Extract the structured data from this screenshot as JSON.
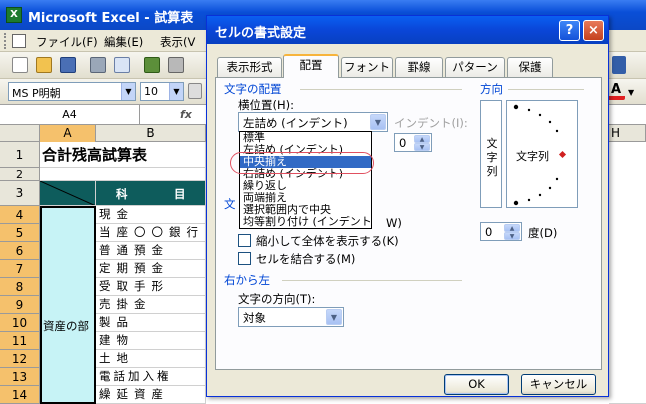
{
  "excel": {
    "title": "Microsoft Excel - 試算表",
    "app_icon": "excel-icon",
    "menu": [
      "ファイル(F)",
      "編集(E)",
      "表示(V"
    ],
    "font_name": "MS P明朝",
    "font_size": "10",
    "name_box": "A4",
    "fx": "fx",
    "columns": [
      "A",
      "B",
      "H"
    ],
    "rows": [
      "1",
      "2",
      "3",
      "4",
      "5",
      "6",
      "7",
      "8",
      "9",
      "10",
      "11",
      "12",
      "13",
      "14"
    ],
    "sheet_title": "合計残高試算表",
    "header_left": "科",
    "header_right": "目",
    "category": "資産の部",
    "accounts": [
      "現金",
      "当座〇〇銀行",
      "普通預金",
      "定期預金",
      "受取手形",
      "売掛金",
      "製品",
      "建物",
      "土地",
      "電話加入権",
      "繰延資産"
    ]
  },
  "dialog": {
    "title": "セルの書式設定",
    "help": "?",
    "close": "×",
    "tabs": [
      "表示形式",
      "配置",
      "フォント",
      "罫線",
      "パターン",
      "保護"
    ],
    "text_align_group": "文字の配置",
    "horizontal_label": "横位置(H):",
    "horizontal_value": "左詰め (インデント)",
    "indent_label": "インデント(I):",
    "indent_value": "0",
    "dropdown_options": [
      "標準",
      "左詰め (インデント)",
      "中央揃え",
      "右詰め (インデント)",
      "繰り返し",
      "両端揃え",
      "選択範囲内で中央",
      "均等割り付け (インデント)"
    ],
    "selected_option_index": 2,
    "text_control_group": "文",
    "wrap_tail": "W)",
    "shrink_label": "縮小して全体を表示する(K)",
    "merge_label": "セルを結合する(M)",
    "rtl_group": "右から左",
    "direction_label": "文字の方向(T):",
    "direction_value": "対象",
    "orientation_group": "方向",
    "vertical_text": [
      "文",
      "字",
      "列"
    ],
    "orientation_text": "文字列",
    "degree_value": "0",
    "degree_label": "度(D)",
    "ok": "OK",
    "cancel": "キャンセル"
  }
}
